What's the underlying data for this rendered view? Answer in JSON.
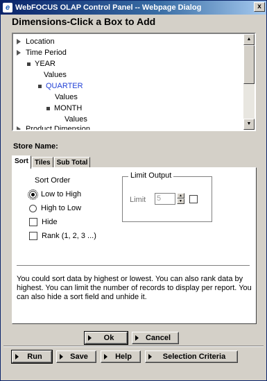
{
  "window": {
    "title": "WebFOCUS OLAP Control Panel -- Webpage Dialog",
    "close_glyph": "x"
  },
  "heading": "Dimensions-Click a Box to Add",
  "tree": {
    "location": "Location",
    "time_period": "Time Period",
    "year": "YEAR",
    "year_values": "Values",
    "quarter": "QUARTER",
    "quarter_values": "Values",
    "month": "MONTH",
    "month_values": "Values",
    "product_dimension": "Product Dimension"
  },
  "store_label": "Store Name:",
  "tabs": {
    "sort": "Sort",
    "tiles": "Tiles",
    "subtotal": "Sub Total"
  },
  "sort_panel": {
    "sort_order_label": "Sort Order",
    "low_to_high": "Low to High",
    "high_to_low": "High to Low",
    "selected": "low_to_high",
    "hide": "Hide",
    "rank": "Rank (1, 2, 3 ...)",
    "limit_output_legend": "Limit Output",
    "limit_label": "Limit",
    "limit_value": "5",
    "help_text": "You could sort data by highest or lowest. You can also rank data by highest. You can limit the number of records to display per report. You can also hide a sort field and unhide it."
  },
  "buttons": {
    "ok": "Ok",
    "cancel": "Cancel",
    "run": "Run",
    "save": "Save",
    "help": "Help",
    "selection_criteria": "Selection Criteria"
  },
  "icons": {
    "app": "ie-logo-icon",
    "scroll_up": "arrow-up-icon",
    "scroll_down": "arrow-down-icon"
  }
}
